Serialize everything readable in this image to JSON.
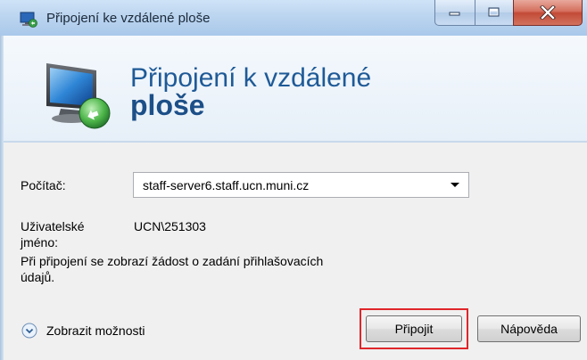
{
  "window": {
    "title": "Připojení ke vzdálené ploše",
    "caption_buttons": {
      "minimize": "minimize-icon",
      "maximize": "maximize-icon",
      "close": "close-icon"
    }
  },
  "banner": {
    "title_line1": "Připojení k vzdálené",
    "title_line2": "ploše",
    "icon": "remote-desktop-monitor-icon"
  },
  "form": {
    "computer_label": "Počítač:",
    "computer_value": "staff-server6.staff.ucn.muni.cz",
    "username_label_line1": "Uživatelské",
    "username_label_line2": "jméno:",
    "username_value": "UCN\\251303",
    "info_line1": "Při připojení se zobrazí žádost o zadání přihlašovacích",
    "info_line2": "údajů."
  },
  "footer": {
    "options_label": "Zobrazit možnosti",
    "connect_label": "Připojit",
    "help_label": "Nápověda"
  },
  "colors": {
    "titlebar": "#bdd6f0",
    "banner_title": "#1f5a97",
    "close_button": "#c24a36",
    "highlight_box": "#e0262a",
    "body_bg": "#f0f0f0"
  }
}
